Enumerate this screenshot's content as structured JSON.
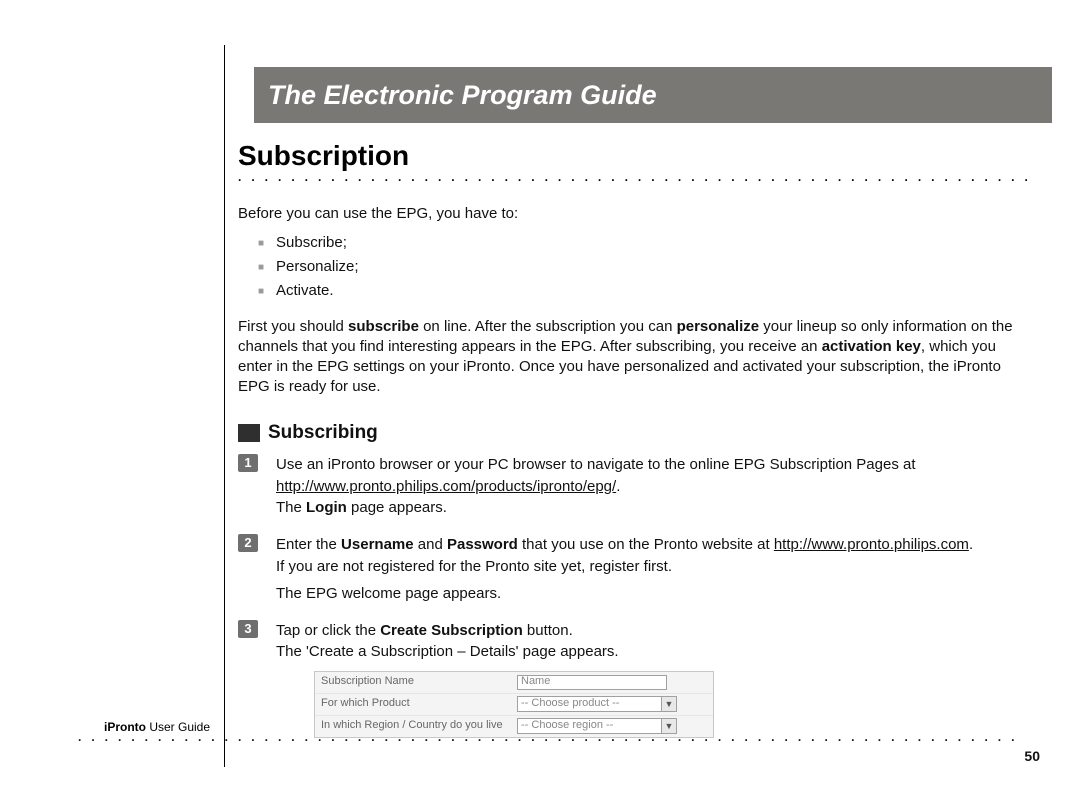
{
  "banner_title": "The Electronic Program Guide",
  "section_title": "Subscription",
  "intro_line": "Before you can use the EPG, you have to:",
  "intro_bullets": [
    "Subscribe;",
    "Personalize;",
    "Activate."
  ],
  "paragraph_parts": {
    "p1a": "First you should ",
    "p1b": "subscribe",
    "p1c": " on line. After the subscription you can ",
    "p1d": "personalize",
    "p1e": " your lineup so only information on the channels that you find interesting appears in the EPG. After subscribing, you receive an ",
    "p1f": "activation key",
    "p1g": ", which you enter in the EPG settings on your iPronto. Once you have personalized and activated your subscription, the iPronto EPG is ready for use."
  },
  "subhead": "Subscribing",
  "steps": [
    {
      "num": "1",
      "line1a": "Use an iPronto browser or your PC browser to navigate to the online EPG Subscription Pages at ",
      "url": "http://www.pronto.philips.com/products/ipronto/epg/",
      "period": ".",
      "line2a": "The ",
      "line2b": "Login",
      "line2c": " page appears."
    },
    {
      "num": "2",
      "line1a": "Enter the ",
      "bold1": "Username",
      "line1b": " and ",
      "bold2": "Password",
      "line1c": " that you use on the Pronto website at ",
      "url": "http://www.pronto.philips.com",
      "period": ".",
      "line2": "If you are not registered for the Pronto site yet, register first.",
      "line3": "The EPG welcome page appears."
    },
    {
      "num": "3",
      "line1a": "Tap or click the ",
      "bold1": "Create Subscription",
      "line1b": " button.",
      "line2": "The 'Create a Subscription – Details' page appears."
    }
  ],
  "form": {
    "row1_label": "Subscription Name",
    "row1_value": "Name",
    "row2_label": "For which Product",
    "row2_value": "-- Choose product --",
    "row3_label": "In which Region / Country do you live",
    "row3_value": "-- Choose region --"
  },
  "footer": {
    "brand": "iPronto",
    "rest": " User Guide"
  },
  "page_number": "50"
}
